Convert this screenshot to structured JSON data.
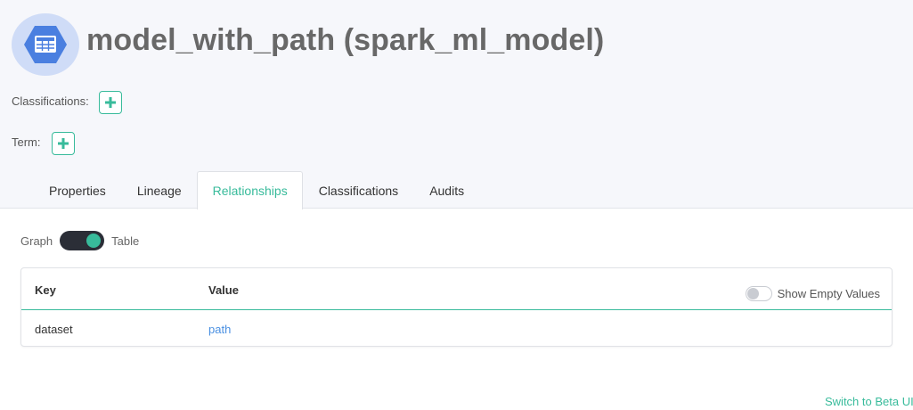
{
  "header": {
    "title": "model_with_path (spark_ml_model)",
    "icon": "table-grid-icon",
    "icon_color": "#4a7fe0",
    "icon_bg": "#cfdcf7"
  },
  "classifications": {
    "label": "Classifications:",
    "add_icon": "plus-icon"
  },
  "term": {
    "label": "Term:",
    "add_icon": "plus-icon"
  },
  "tabs": [
    {
      "label": "Properties",
      "active": false
    },
    {
      "label": "Lineage",
      "active": false
    },
    {
      "label": "Relationships",
      "active": true
    },
    {
      "label": "Classifications",
      "active": false
    },
    {
      "label": "Audits",
      "active": false
    }
  ],
  "view_switch": {
    "left_label": "Graph",
    "right_label": "Table",
    "selected": "Table"
  },
  "table": {
    "headers": {
      "key": "Key",
      "value": "Value"
    },
    "show_empty_label": "Show Empty Values",
    "show_empty_on": false,
    "rows": [
      {
        "key": "dataset",
        "value": "path"
      }
    ]
  },
  "footer": {
    "beta_link": "Switch to Beta UI"
  },
  "colors": {
    "accent": "#38bb9b",
    "link": "#4a90e2",
    "title": "#686868"
  }
}
